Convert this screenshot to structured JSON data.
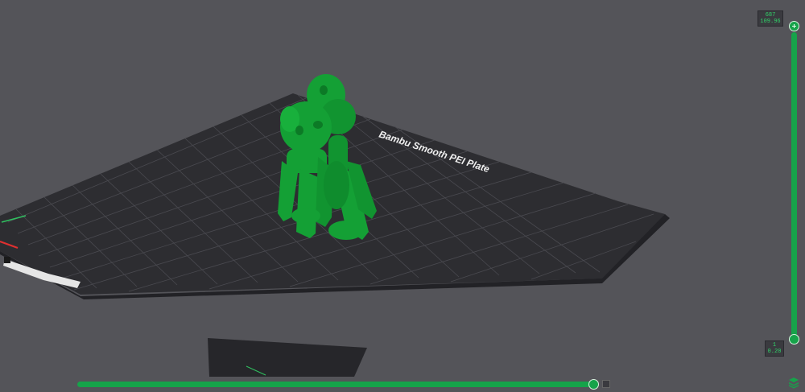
{
  "plate": {
    "name": "Bambu Smooth PEI Plate"
  },
  "layer_slider": {
    "top_layer": "687",
    "top_height": "109.96",
    "bottom_layer": "1",
    "bottom_height": "0.20"
  },
  "move_slider": {
    "progress": 1.0
  },
  "icons": {
    "top_handle": "plus-icon",
    "settings": "layers-icon"
  },
  "colors": {
    "background": "#545459",
    "plate": "#2d2d31",
    "grid": "#56565c",
    "model": "#14a035",
    "accent": "#16a34a"
  }
}
